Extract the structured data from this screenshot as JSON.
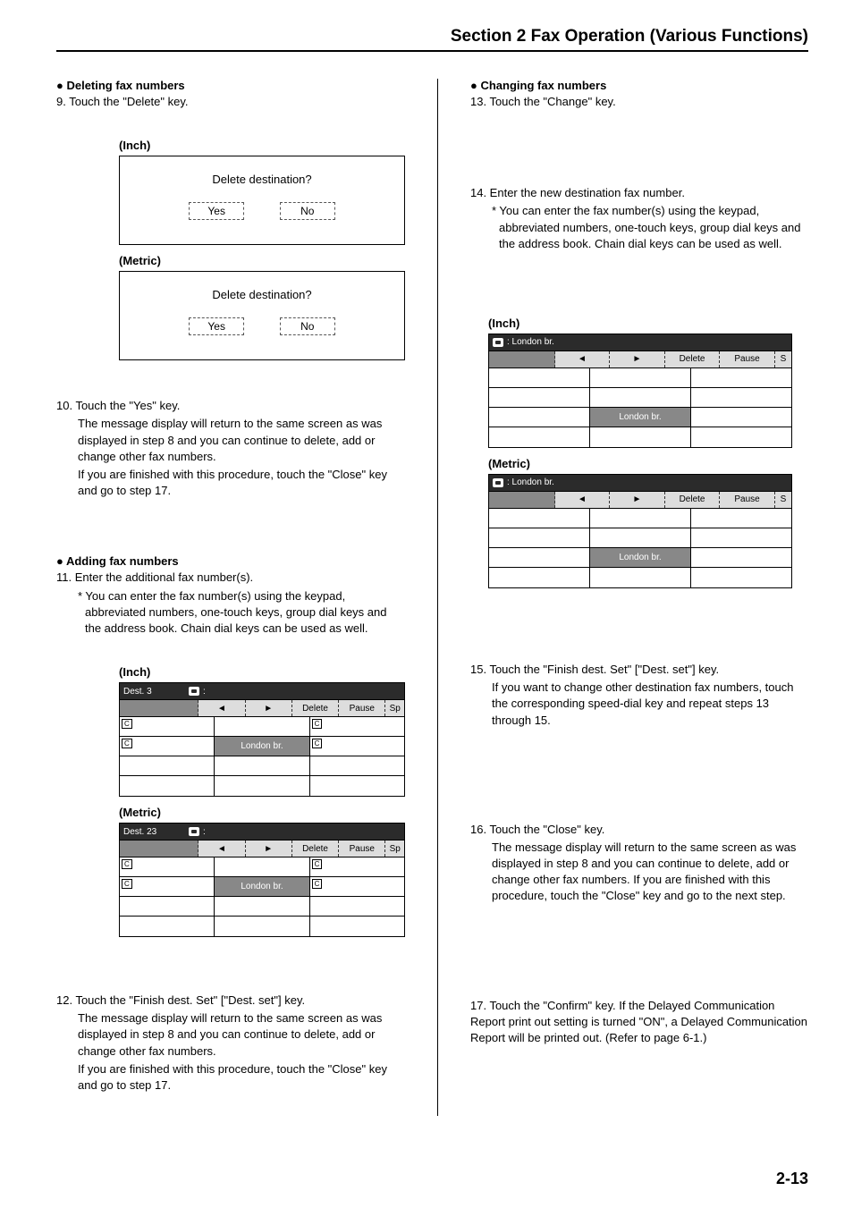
{
  "header": {
    "title": "Section 2  Fax Operation (Various Functions)"
  },
  "left": {
    "del_head": "● Deleting fax numbers",
    "step9": "9. Touch the \"Delete\" key.",
    "inch_label": "(Inch)",
    "metric_label": "(Metric)",
    "dlg_inch_prompt": "Delete destination?",
    "dlg_metric_prompt": "Delete destination?",
    "yes": "Yes",
    "no": "No",
    "step10a": "10. Touch the \"Yes\" key.",
    "step10b": "The message display will return to the same screen as was displayed in step 8 and you can continue to delete, add or change other fax numbers.",
    "step10c": "If you are finished with this procedure, touch the \"Close\" key and go to step 17.",
    "add_head": "● Adding fax numbers",
    "step11a": "11. Enter the additional fax number(s).",
    "step11b": "* You can enter the fax number(s) using the keypad, abbreviated numbers, one-touch keys, group dial keys and the address book. Chain dial keys can be used as well.",
    "panel_inch_header": "Dest. 3",
    "panel_metric_header": "Dest. 23",
    "tb_delete": "Delete",
    "tb_pause": "Pause",
    "tb_sp": "Sp",
    "cell_london": "London br.",
    "step12a": "12. Touch the \"Finish dest. Set\" [\"Dest. set\"] key.",
    "step12b": "The message display will return to the same screen as was displayed in step 8 and you can continue to delete, add or change other fax numbers.",
    "step12c": "If you are finished with this procedure, touch the \"Close\" key and go to step 17."
  },
  "right": {
    "chg_head": "● Changing fax numbers",
    "step13": "13. Touch the \"Change\" key.",
    "step14a": "14. Enter the new destination fax number.",
    "step14b": "* You can enter the fax number(s) using the keypad, abbreviated numbers, one-touch keys, group dial keys and the address book. Chain dial keys can be used as well.",
    "inch_label": "(Inch)",
    "metric_label": "(Metric)",
    "panel_hdr_text": ": London br.",
    "tb_delete": "Delete",
    "tb_pause": "Pause",
    "tb_s": "S",
    "cell_london": "London br.",
    "step15a": "15. Touch the \"Finish dest. Set\" [\"Dest. set\"] key.",
    "step15b": "If you want to change other destination fax numbers, touch the corresponding speed-dial key and repeat steps 13 through 15.",
    "step16a": "16. Touch the \"Close\" key.",
    "step16b": "The message display will return to the same screen as was displayed in step 8 and you can continue to delete, add or change other fax numbers. If you are finished with this procedure, touch the \"Close\" key and go to the next step.",
    "step17": "17. Touch the \"Confirm\" key. If the Delayed Communication Report print out setting is turned \"ON\", a Delayed Communication Report will be printed out. (Refer to page 6-1.)"
  },
  "pagenum": "2-13"
}
